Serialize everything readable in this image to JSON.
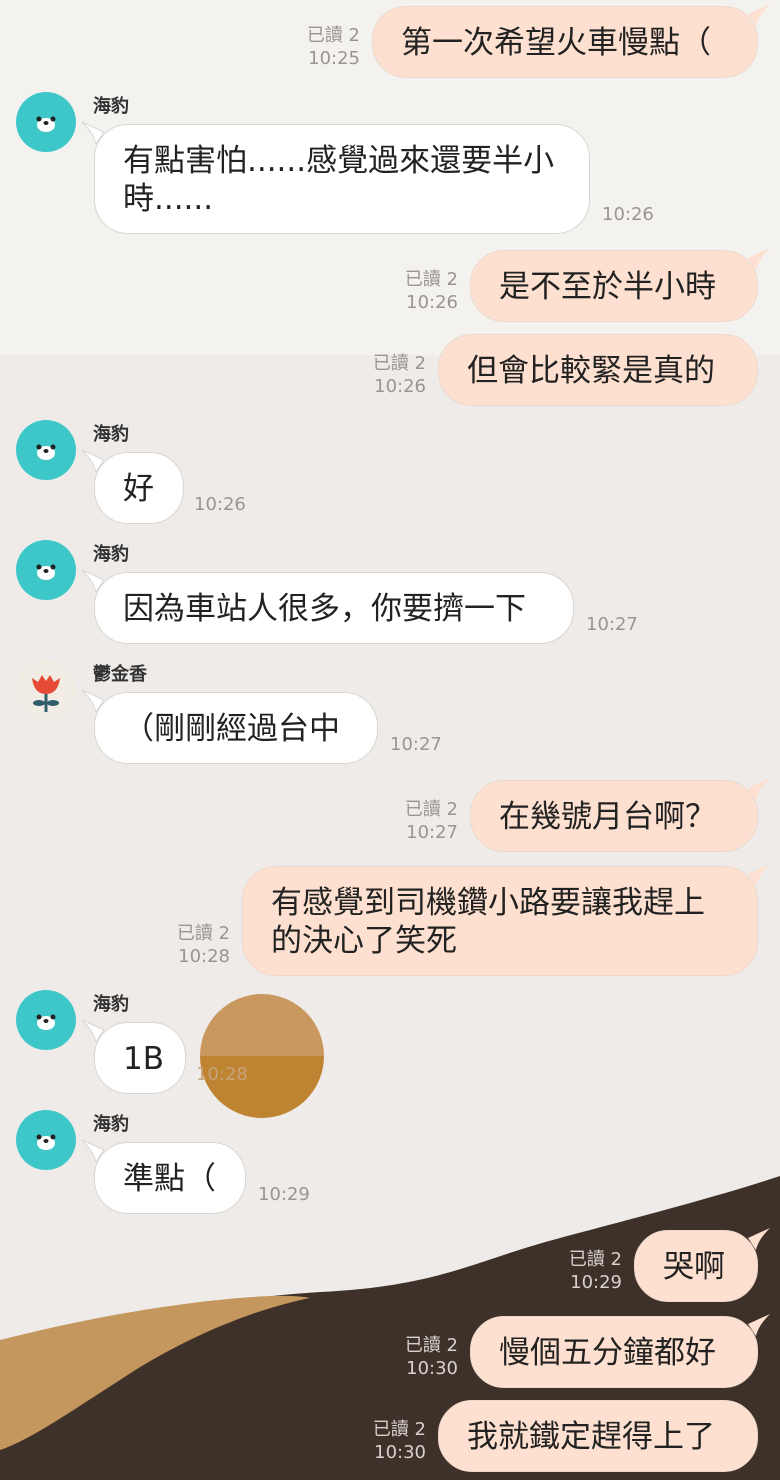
{
  "participants": {
    "seal": {
      "name": "海豹",
      "avatar_icon": "seal-face-icon"
    },
    "tulip": {
      "name": "鬱金香",
      "avatar_icon": "tulip-icon"
    }
  },
  "messages": [
    {
      "id": "m1",
      "side": "out",
      "text": "第一次希望火車慢點（",
      "read": "已讀 2",
      "time": "10:25"
    },
    {
      "id": "m2",
      "side": "in",
      "sender": "海豹",
      "text_line1": "有點害怕......感覺過來還要半小",
      "text_line2": "時......",
      "time": "10:26"
    },
    {
      "id": "m3",
      "side": "out",
      "text": "是不至於半小時",
      "read": "已讀 2",
      "time": "10:26"
    },
    {
      "id": "m4",
      "side": "out",
      "text": "但會比較緊是真的",
      "read": "已讀 2",
      "time": "10:26"
    },
    {
      "id": "m5",
      "side": "in",
      "sender": "海豹",
      "text": "好",
      "time": "10:26"
    },
    {
      "id": "m6",
      "side": "in",
      "sender": "海豹",
      "text": "因為車站人很多，你要擠一下",
      "time": "10:27"
    },
    {
      "id": "m7",
      "side": "in",
      "sender": "鬱金香",
      "text": "（剛剛經過台中",
      "time": "10:27"
    },
    {
      "id": "m8",
      "side": "out",
      "text": "在幾號月台啊？",
      "read": "已讀 2",
      "time": "10:27"
    },
    {
      "id": "m9",
      "side": "out",
      "text_line1": "有感覺到司機鑽小路要讓我趕上",
      "text_line2": "的決心了笑死",
      "read": "已讀 2",
      "time": "10:28"
    },
    {
      "id": "m10",
      "side": "in",
      "sender": "海豹",
      "text": "1B",
      "time": "10:28"
    },
    {
      "id": "m11",
      "side": "in",
      "sender": "海豹",
      "text": "準點（",
      "time": "10:29"
    },
    {
      "id": "m12",
      "side": "out",
      "text": "哭啊",
      "read": "已讀 2",
      "time": "10:29"
    },
    {
      "id": "m13",
      "side": "out",
      "text": "慢個五分鐘都好",
      "read": "已讀 2",
      "time": "10:30"
    },
    {
      "id": "m14",
      "side": "out",
      "text": "我就鐵定趕得上了",
      "read": "已讀 2",
      "time": "10:30"
    }
  ],
  "colors": {
    "outgoing_bubble": "#fde0d0",
    "incoming_bubble": "#ffffff",
    "seal_avatar": "#3ec7c9",
    "wave_dark": "#3d3129",
    "wave_tan": "#c4975e",
    "sticker_top": "#c9985e",
    "sticker_bottom": "#bf8431"
  }
}
